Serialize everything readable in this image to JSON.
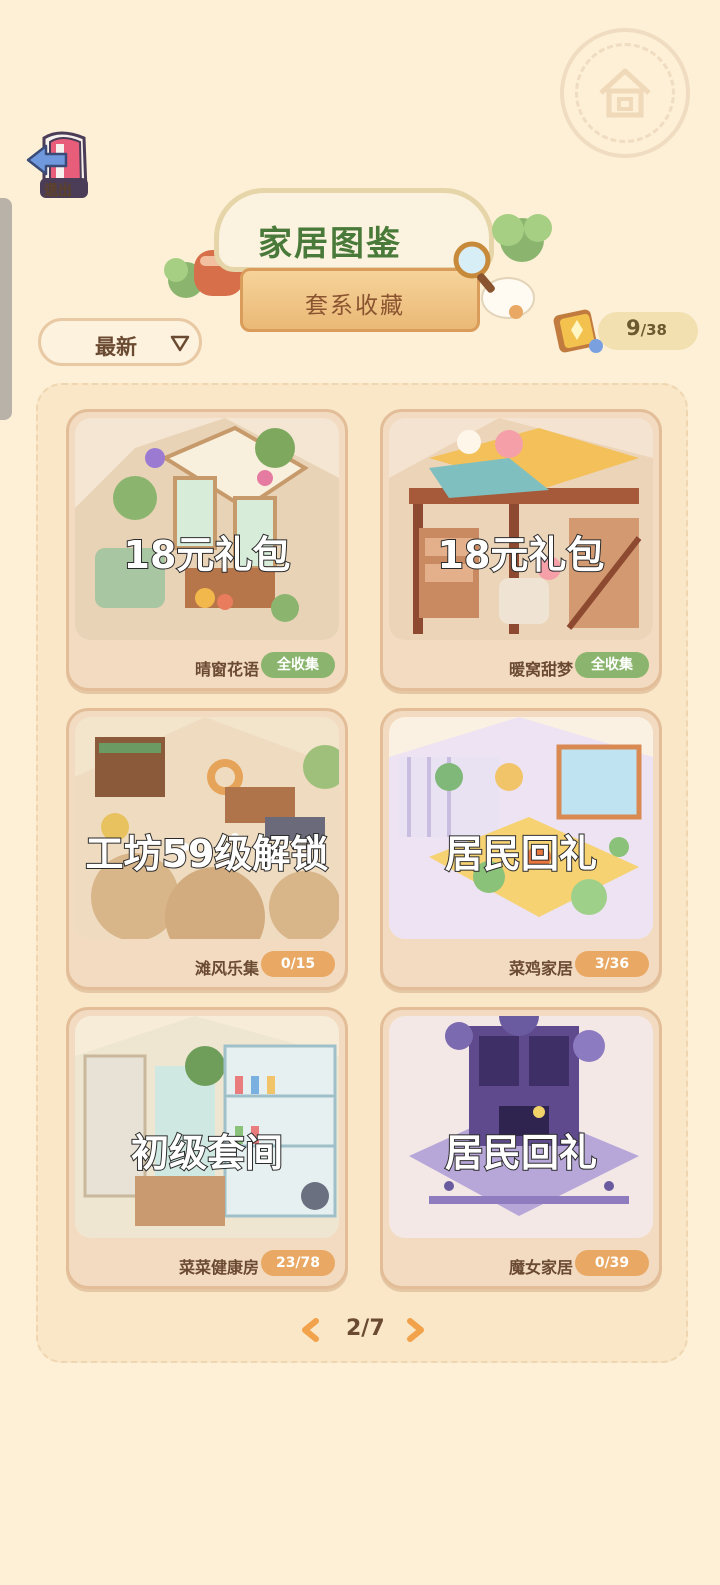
{
  "header": {
    "exit_label": "退出",
    "title": "家居图鉴",
    "subtitle": "套系收藏"
  },
  "sort": {
    "label": "最新"
  },
  "collection_counter": {
    "current": "9",
    "total": "/38"
  },
  "cards": [
    {
      "name": "晴窗花语",
      "overlay": "18元礼包",
      "badge": "全收集",
      "badge_color": "#8bb56e"
    },
    {
      "name": "暖窝甜梦",
      "overlay": "18元礼包",
      "badge": "全收集",
      "badge_color": "#8bb56e"
    },
    {
      "name": "滩风乐集",
      "overlay": "工坊59级解锁",
      "badge": "0/15",
      "badge_color": "#e9a964"
    },
    {
      "name": "菜鸡家居",
      "overlay": "居民回礼",
      "badge": "3/36",
      "badge_color": "#e9a964"
    },
    {
      "name": "菜菜健康房",
      "overlay": "初级套间",
      "badge": "23/78",
      "badge_color": "#e9a964"
    },
    {
      "name": "魔女家居",
      "overlay": "居民回礼",
      "badge": "0/39",
      "badge_color": "#e9a964"
    }
  ],
  "pagination": {
    "label": "2/7"
  },
  "colors": {
    "background": "#fdf0d6",
    "title_green": "#4a7a3a",
    "accent_orange": "#f2a24a"
  }
}
